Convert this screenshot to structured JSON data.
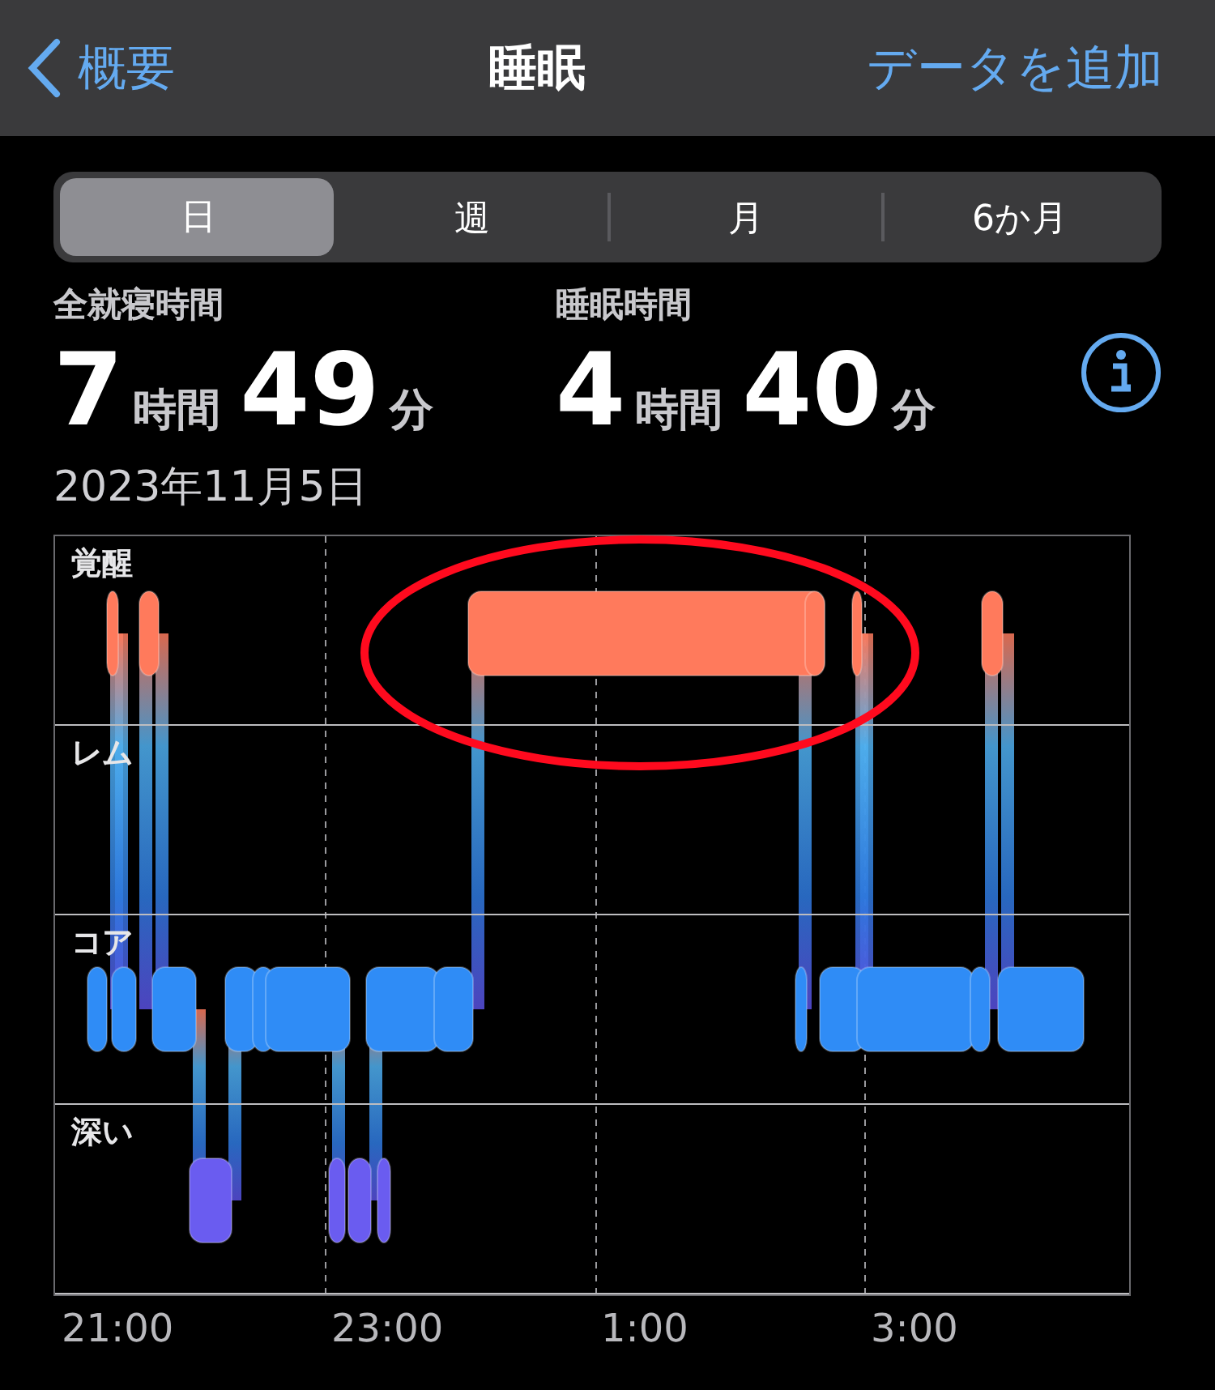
{
  "nav": {
    "back": "概要",
    "title": "睡眠",
    "action": "データを追加"
  },
  "periods": [
    {
      "label": "日",
      "selected": true
    },
    {
      "label": "週",
      "selected": false
    },
    {
      "label": "月",
      "selected": false
    },
    {
      "label": "6か月",
      "selected": false
    }
  ],
  "stats": [
    {
      "label": "全就寝時間",
      "hours": "7",
      "hours_unit": "時間",
      "minutes": "49",
      "minutes_unit": "分"
    },
    {
      "label": "睡眠時間",
      "hours": "4",
      "hours_unit": "時間",
      "minutes": "40",
      "minutes_unit": "分"
    }
  ],
  "date": "2023年11月5日",
  "chart": {
    "stages": [
      "覚醒",
      "レム",
      "コア",
      "深い"
    ],
    "times": [
      "21:00",
      "23:00",
      "1:00",
      "3:00"
    ],
    "annotation": {
      "kind": "ellipse"
    }
  }
}
